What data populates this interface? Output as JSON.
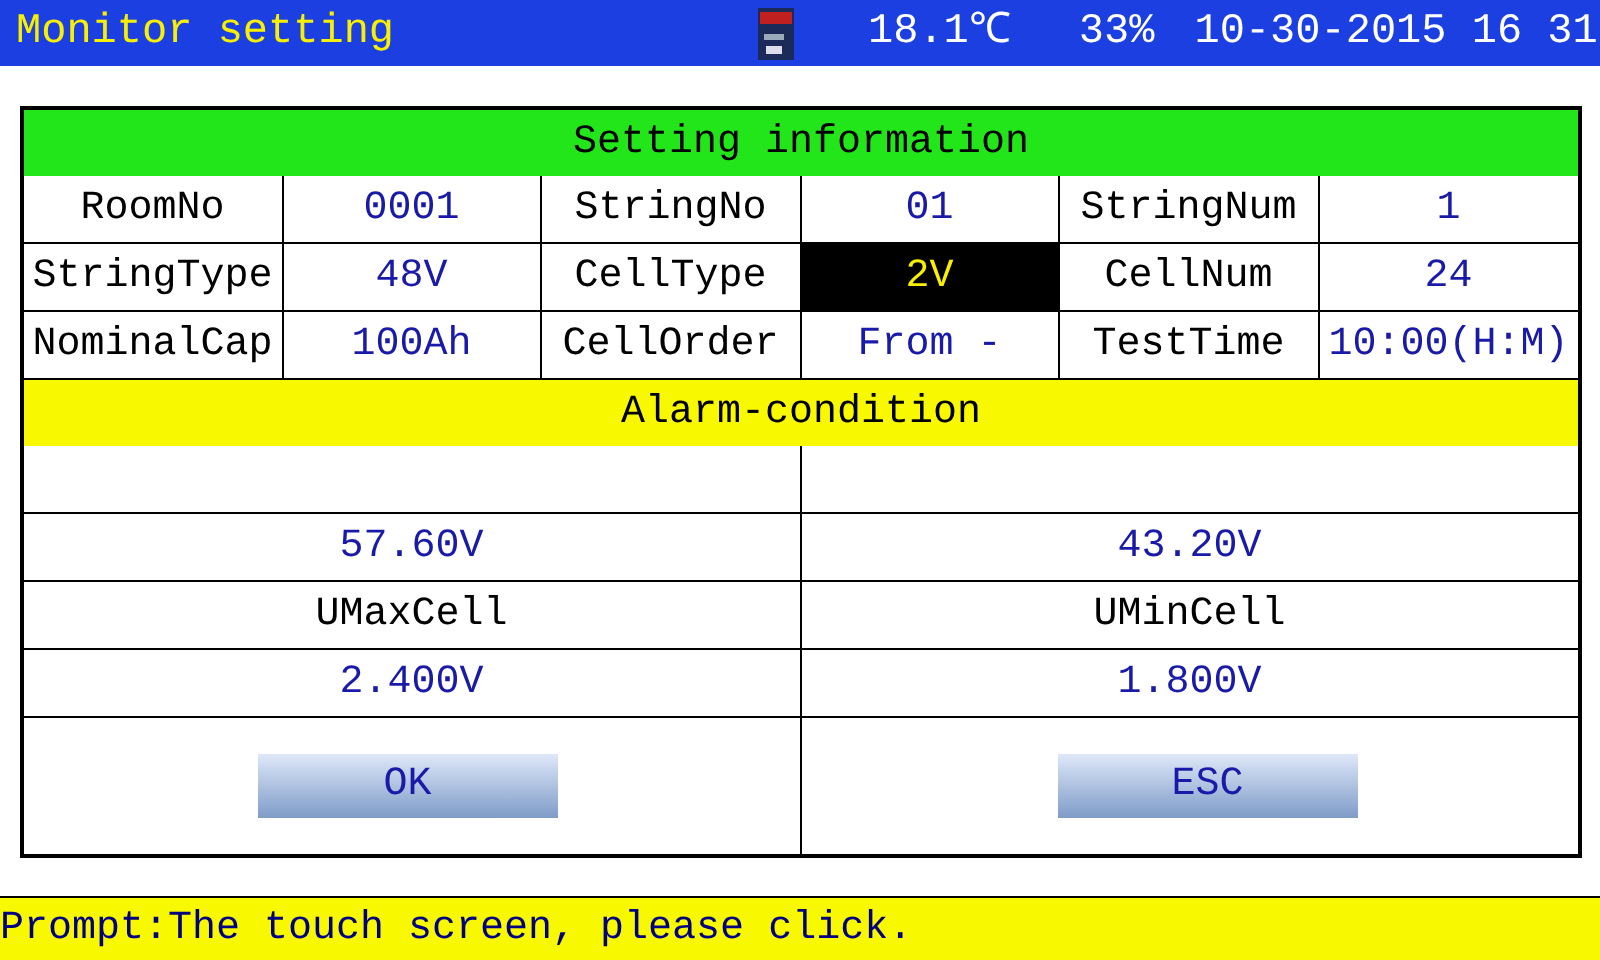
{
  "title_bar": {
    "title": "Monitor setting",
    "temperature": "18.1℃",
    "humidity": "33%",
    "datetime": "10-30-2015 16 31"
  },
  "setting_information": {
    "title": "Setting information",
    "rows": [
      [
        {
          "label": "RoomNo",
          "value": "0001",
          "selected": false
        },
        {
          "label": "StringNo",
          "value": "01",
          "selected": false
        },
        {
          "label": "StringNum",
          "value": "1",
          "selected": false
        }
      ],
      [
        {
          "label": "StringType",
          "value": "48V",
          "selected": false
        },
        {
          "label": "CellType",
          "value": "2V",
          "selected": true
        },
        {
          "label": "CellNum",
          "value": "24",
          "selected": false
        }
      ],
      [
        {
          "label": "NominalCap",
          "value": "100Ah",
          "selected": false
        },
        {
          "label": "CellOrder",
          "value": "From -",
          "selected": false
        },
        {
          "label": "TestTime",
          "value": "10:00(H:M)",
          "selected": false
        }
      ]
    ]
  },
  "alarm_condition": {
    "title": "Alarm-condition",
    "items": [
      {
        "value": "57.60V"
      },
      {
        "value": "43.20V"
      },
      {
        "label": "UMaxCell",
        "value": "2.400V"
      },
      {
        "label": "UMinCell",
        "value": "1.800V"
      }
    ]
  },
  "buttons": [
    "OK",
    "ESC"
  ],
  "prompt": "Prompt:The touch screen, please click."
}
